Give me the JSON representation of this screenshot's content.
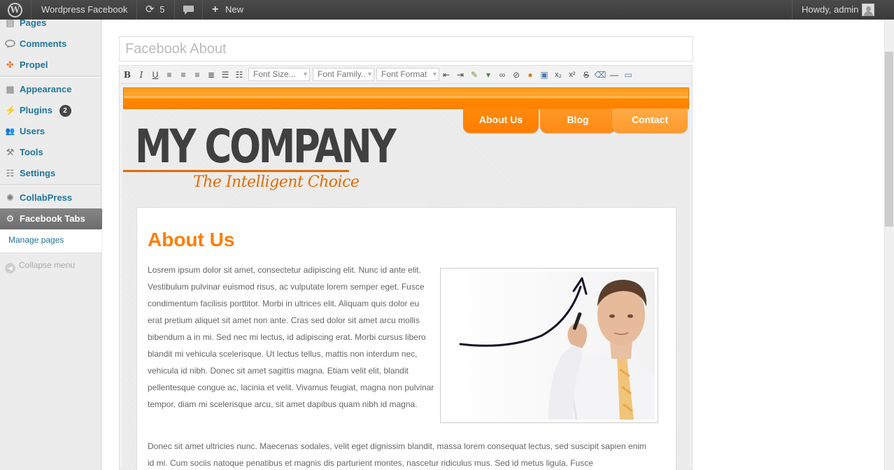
{
  "admin_bar": {
    "wp_logo": "W",
    "site_name": "Wordpress Facebook",
    "updates_count": "5",
    "new_label": "New",
    "greeting": "Howdy, admin"
  },
  "sidebar": {
    "items": [
      {
        "label": "Pages",
        "icon": "pages-icon",
        "glyph": "▤"
      },
      {
        "label": "Comments",
        "icon": "comments-icon",
        "glyph": "💬"
      },
      {
        "label": "Propel",
        "icon": "propel-icon",
        "glyph": "✤"
      },
      {
        "label": "Appearance",
        "icon": "appearance-icon",
        "glyph": "▦"
      },
      {
        "label": "Plugins",
        "icon": "plugins-icon",
        "glyph": "⚡",
        "badge": "2"
      },
      {
        "label": "Users",
        "icon": "users-icon",
        "glyph": "👥"
      },
      {
        "label": "Tools",
        "icon": "tools-icon",
        "glyph": "⚒"
      },
      {
        "label": "Settings",
        "icon": "settings-icon",
        "glyph": "☷"
      },
      {
        "label": "CollabPress",
        "icon": "collabpress-icon",
        "glyph": "✺"
      }
    ],
    "active": {
      "label": "Facebook Tabs",
      "icon": "gear-icon",
      "glyph": "⚙"
    },
    "submenu": {
      "label": "Manage pages"
    },
    "collapse": {
      "label": "Collapse menu"
    }
  },
  "editor": {
    "title_value": "Facebook About",
    "toolbar": {
      "font_size": "Font Size...",
      "font_family": "Font Family..",
      "font_format": "Font Format"
    }
  },
  "page_preview": {
    "nav": [
      "About Us",
      "Blog",
      "Contact"
    ],
    "logo": "MY COMPANY",
    "tagline": "The Intelligent Choice",
    "heading": "About Us",
    "paragraph1": "Losrem ipsum dolor sit amet, consectetur adipiscing elit. Nunc id ante elit. Vestibulum pulvinar euismod risus, ac vulputate lorem semper eget. Fusce condimentum facilisis porttitor. Morbi in ultrices elit. Aliquam quis dolor eu erat pretium aliquet sit amet non ante. Cras sed dolor sit amet arcu mollis bibendum a in mi. Sed nec mi lectus, id adipiscing erat. Morbi cursus libero blandit mi vehicula scelerisque. Ut lectus tellus, mattis non interdum nec, vehicula id nibh. Donec sit amet sagittis magna. Etiam velit elit, blandit pellentesque congue ac, lacinia et velit. Vivamus feugiat, magna non pulvinar tempor, diam mi scelerisque arcu, sit amet dapibus quam nibh id magna.",
    "paragraph2": "Donec sit amet ultricies nunc. Maecenas sodales, velit eget dignissim blandit, massa lorem consequat lectus, sed suscipit sapien enim id mi. Cum sociis natoque penatibus et magnis dis parturient montes, nascetur ridiculus mus. Sed id metus ligula. Fusce"
  },
  "colors": {
    "accent_orange": "#ff7d00",
    "link_blue": "#21759b",
    "admin_bar": "#464646"
  }
}
